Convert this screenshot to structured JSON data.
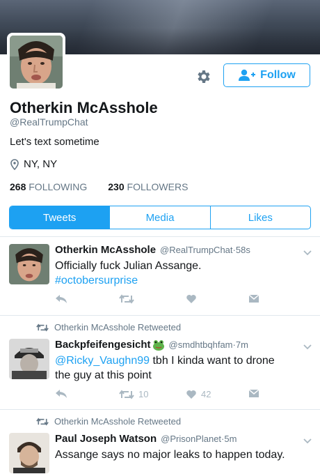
{
  "profile": {
    "name": "Otherkin McAsshole",
    "handle": "@RealTrumpChat",
    "bio": "Let's text sometime",
    "location": "NY, NY",
    "following_count": "268",
    "following_label": "FOLLOWING",
    "followers_count": "230",
    "followers_label": "FOLLOWERS",
    "follow_label": "Follow"
  },
  "tabs": [
    {
      "label": "Tweets",
      "active": true
    },
    {
      "label": "Media",
      "active": false
    },
    {
      "label": "Likes",
      "active": false
    }
  ],
  "tweets": [
    {
      "retweeted_by": "",
      "name": "Otherkin McAsshole",
      "handle": "@RealTrumpChat",
      "time": "58s",
      "text": "Officially fuck Julian Assange.",
      "hashtag": "#octobersurprise",
      "retweets": "",
      "likes": ""
    },
    {
      "retweeted_by": "Otherkin McAsshole Retweeted",
      "name": "Backpfeifengesicht",
      "name_emoji": "frog-emoji",
      "handle": "@smdhtbqhfam",
      "time": "7m",
      "mention": "@Ricky_Vaughn99",
      "text_line1": " tbh I kinda want to drone",
      "text_line2": "the guy at this point",
      "retweets": "10",
      "likes": "42"
    },
    {
      "retweeted_by": "Otherkin McAsshole Retweeted",
      "name": "Paul Joseph Watson",
      "handle": "@PrisonPlanet",
      "time": "5m",
      "text": "Assange says no major leaks to happen today."
    }
  ],
  "meta_sep": " · ",
  "colors": {
    "accent": "#1da1f2",
    "muted": "#657786",
    "icon": "#aab8c2",
    "divider": "#e1e8ed"
  },
  "icons": [
    "gear-icon",
    "add-user-icon",
    "location-pin-icon",
    "reply-icon",
    "retweet-icon",
    "like-icon",
    "message-icon",
    "chevron-down-icon"
  ]
}
